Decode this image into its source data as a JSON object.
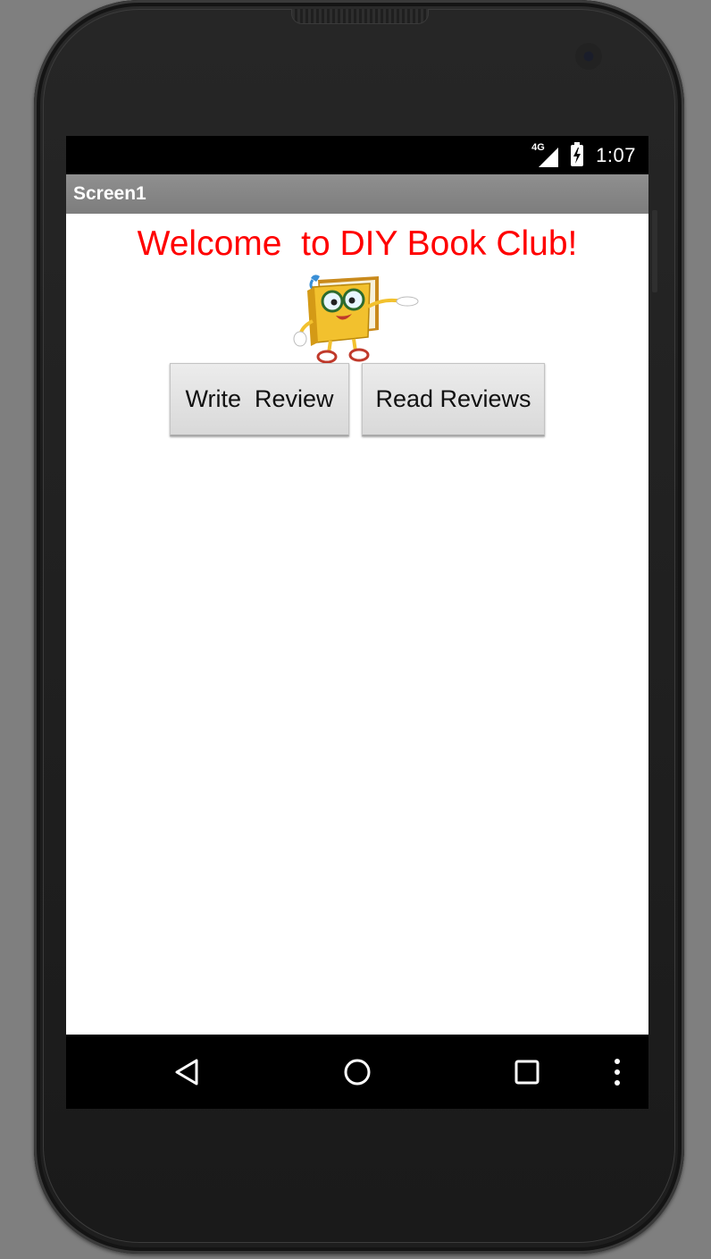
{
  "status_bar": {
    "network_label": "4G",
    "time": "1:07"
  },
  "title_bar": {
    "title": "Screen1"
  },
  "content": {
    "welcome_text": "Welcome  to DIY Book Club!",
    "welcome_color": "#ff0000",
    "mascot_icon": "book-mascot-icon",
    "buttons": {
      "write_review": "Write  Review",
      "read_reviews": "Read Reviews"
    }
  },
  "nav_bar": {
    "items": [
      {
        "icon": "back-triangle-icon"
      },
      {
        "icon": "home-circle-icon"
      },
      {
        "icon": "recents-square-icon"
      },
      {
        "icon": "overflow-menu-icon"
      }
    ]
  }
}
